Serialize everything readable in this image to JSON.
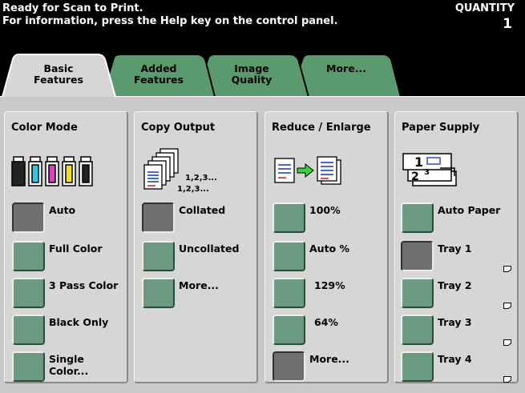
{
  "status": {
    "line1": "Ready for Scan to Print.",
    "line2": "For information, press the Help key on the control panel.",
    "quantity_label": "QUANTITY",
    "quantity_value": "1"
  },
  "tabs": [
    {
      "line1": "Basic",
      "line2": "Features",
      "active": true
    },
    {
      "line1": "Added",
      "line2": "Features",
      "active": false
    },
    {
      "line1": "Image",
      "line2": "Quality",
      "active": false
    },
    {
      "line1": "",
      "line2": "More...",
      "active": false
    }
  ],
  "columns": {
    "color_mode": {
      "title": "Color Mode",
      "options": [
        {
          "label": "Auto",
          "selected": true
        },
        {
          "label": "Full Color",
          "selected": false
        },
        {
          "label": "3 Pass Color",
          "selected": false
        },
        {
          "label": "Black Only",
          "selected": false
        },
        {
          "label": "Single\nColor...",
          "selected": false
        }
      ]
    },
    "copy_output": {
      "title": "Copy Output",
      "icon_text1": "1,2,3...",
      "icon_text2": "1,2,3...",
      "options": [
        {
          "label": "Collated",
          "selected": true
        },
        {
          "label": "Uncollated",
          "selected": false
        },
        {
          "label": "More...",
          "selected": false
        }
      ]
    },
    "reduce_enlarge": {
      "title": "Reduce / Enlarge",
      "options": [
        {
          "label": "100%",
          "selected": false
        },
        {
          "label": "Auto %",
          "selected": false
        },
        {
          "label": "129%",
          "selected": false
        },
        {
          "label": "64%",
          "selected": false
        },
        {
          "label": "More...",
          "selected": true
        }
      ]
    },
    "paper_supply": {
      "title": "Paper Supply",
      "options": [
        {
          "label": "Auto Paper",
          "selected": false
        },
        {
          "label": "Tray 1",
          "selected": true
        },
        {
          "label": "Tray 2",
          "selected": false
        },
        {
          "label": "Tray 3",
          "selected": false
        },
        {
          "label": "Tray 4",
          "selected": false
        }
      ]
    }
  },
  "colors": {
    "button_green": "#6c9a80",
    "button_selected": "#6f6f6f",
    "tab_green": "#5b9a6e",
    "tab_active": "#d6d6d6"
  }
}
